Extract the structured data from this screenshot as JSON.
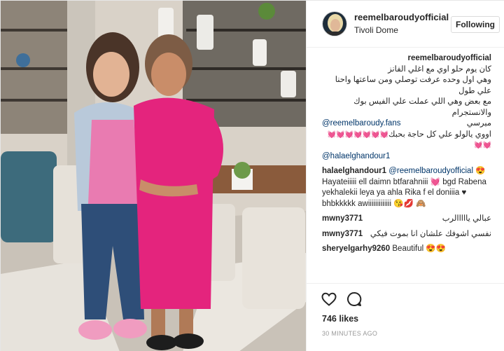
{
  "post": {
    "author": "reemelbaroudyofficial",
    "location": "Tivoli Dome",
    "follow_label": "Following",
    "caption": {
      "username": "reemelbaroudyofficial",
      "line1": "كان يوم حلو اوي مع اغلي الفانز",
      "line2": "وهي اول وحده عرفت توصلي ومن ساعتها واحنا علي طول",
      "line3": "مع بعض وهي اللي عملت علي الفيس بوك والانستجرام",
      "mention1": "@reemelbaroudy.fans",
      "mention1_suffix": "ميرسي",
      "hearts": "💓💓💓💓💓💓💓💓💓",
      "line5": "اووي يالولو علي كل حاجة بحبك",
      "mention2": "@halaelghandour1"
    },
    "comments": [
      {
        "username": "halaelghandour1",
        "mention": "@reemelbaroudyofficial",
        "emoji": "😍",
        "text_lines": [
          "Hayateiiiii ell daimn btfarahniii 💓 bgd Rabena",
          "yekhalekii leya ya ahla Rika f el doniiia ♥",
          "bhbkkkkk awiiiiiiiiiiiii 😘💋 🙈"
        ]
      },
      {
        "username": "mwny3771",
        "text": "عبالي يااااالرب"
      },
      {
        "username": "mwny3771",
        "text": "نفسي اشوفك علشان انا بموت فيكي"
      },
      {
        "username": "sheryelgarhy9260",
        "text": "Beautiful 😍😍"
      }
    ],
    "likes": "746 likes",
    "timestamp": "30 MINUTES AGO"
  },
  "icons": {
    "like": "heart-outline-icon",
    "comment": "speech-bubble-icon"
  },
  "colors": {
    "link": "#003569",
    "text": "#262626",
    "muted": "#999999",
    "border": "#efefef",
    "dress_pink": "#e4247d"
  }
}
